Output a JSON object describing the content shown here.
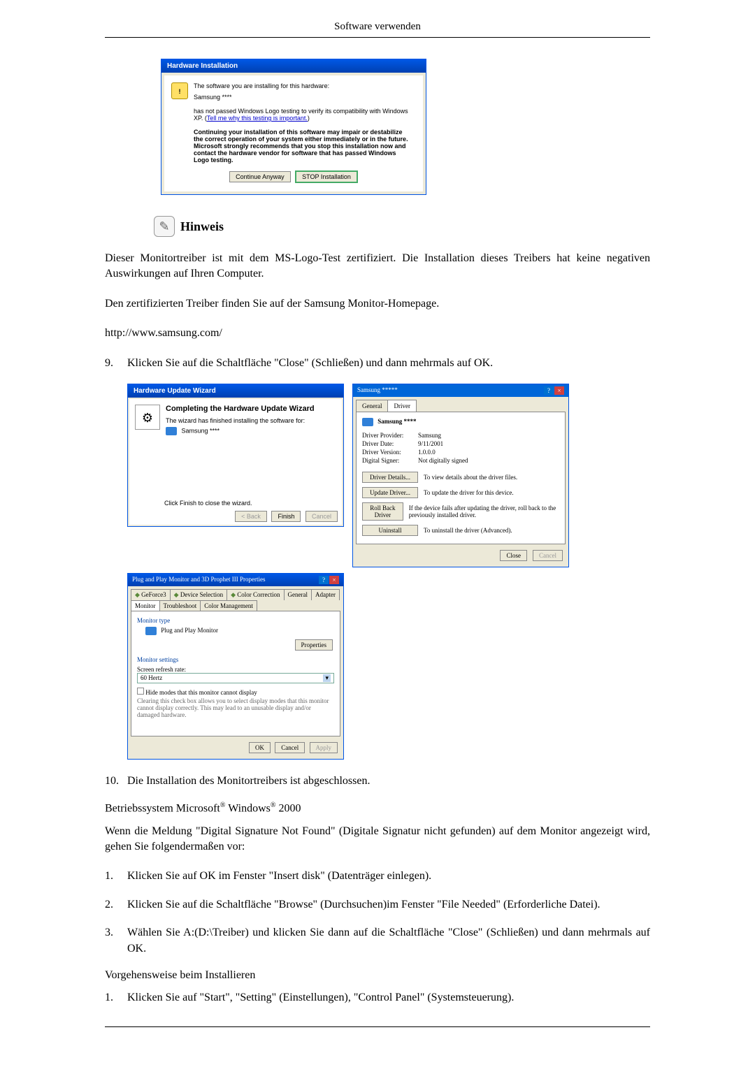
{
  "header": {
    "title": "Software verwenden"
  },
  "hwinstall": {
    "title": "Hardware Installation",
    "line1": "The software you are installing for this hardware:",
    "device": "Samsung ****",
    "line2a": "has not passed Windows Logo testing to verify its compatibility with Windows XP. (",
    "line2link": "Tell me why this testing is important.",
    "line2b": ")",
    "bold": "Continuing your installation of this software may impair or destabilize the correct operation of your system either immediately or in the future. Microsoft strongly recommends that you stop this installation now and contact the hardware vendor for software that has passed Windows Logo testing.",
    "btn_continue": "Continue Anyway",
    "btn_stop": "STOP Installation"
  },
  "note": {
    "label": "Hinweis",
    "para1": "Dieser Monitortreiber ist mit dem MS-Logo-Test zertifiziert. Die Installation dieses Treibers hat keine negativen Auswirkungen auf Ihren Computer.",
    "para2": "Den zertifizierten Treiber finden Sie auf der Samsung Monitor-Homepage.",
    "url": "http://www.samsung.com/"
  },
  "step9": {
    "num": "9.",
    "text": "Klicken Sie auf die Schaltfläche \"Close\" (Schließen) und dann mehrmals auf OK."
  },
  "wizard": {
    "title": "Hardware Update Wizard",
    "heading": "Completing the Hardware Update Wizard",
    "sub": "The wizard has finished installing the software for:",
    "device": "Samsung ****",
    "hint": "Click Finish to close the wizard.",
    "btn_back": "< Back",
    "btn_finish": "Finish",
    "btn_cancel": "Cancel"
  },
  "driverprops": {
    "title": "Samsung *****",
    "tab_general": "General",
    "tab_driver": "Driver",
    "device": "Samsung ****",
    "provider_k": "Driver Provider:",
    "provider_v": "Samsung",
    "date_k": "Driver Date:",
    "date_v": "9/11/2001",
    "version_k": "Driver Version:",
    "version_v": "1.0.0.0",
    "signer_k": "Digital Signer:",
    "signer_v": "Not digitally signed",
    "btn_details": "Driver Details...",
    "desc_details": "To view details about the driver files.",
    "btn_update": "Update Driver...",
    "desc_update": "To update the driver for this device.",
    "btn_rollback": "Roll Back Driver",
    "desc_rollback": "If the device fails after updating the driver, roll back to the previously installed driver.",
    "btn_uninstall": "Uninstall",
    "desc_uninstall": "To uninstall the driver (Advanced).",
    "btn_close": "Close",
    "btn_cancel": "Cancel"
  },
  "monprops": {
    "title": "Plug and Play Monitor and 3D Prophet III Properties",
    "tabs": {
      "geforce": "GeForce3",
      "devsel": "Device Selection",
      "colorcorr": "Color Correction",
      "general": "General",
      "adapter": "Adapter",
      "monitor": "Monitor",
      "trouble": "Troubleshoot",
      "colormgmt": "Color Management"
    },
    "montype_label": "Monitor type",
    "montype_value": "Plug and Play Monitor",
    "btn_properties": "Properties",
    "settings_label": "Monitor settings",
    "refresh_label": "Screen refresh rate:",
    "refresh_value": "60 Hertz",
    "hide_label": "Hide modes that this monitor cannot display",
    "hide_desc": "Clearing this check box allows you to select display modes that this monitor cannot display correctly. This may lead to an unusable display and/or damaged hardware.",
    "btn_ok": "OK",
    "btn_cancel": "Cancel",
    "btn_apply": "Apply"
  },
  "step10": {
    "num": "10.",
    "text": "Die Installation des Monitortreibers ist abgeschlossen."
  },
  "os2000": {
    "line_prefix": "Betriebssystem Microsoft",
    "mid": " Windows",
    "suffix": " 2000",
    "reg": "®",
    "para": "Wenn die Meldung \"Digital Signature Not Found\" (Digitale Signatur nicht gefunden) auf dem Monitor angezeigt wird, gehen Sie folgendermaßen vor:",
    "s1_num": "1.",
    "s1_text": "Klicken Sie auf OK im Fenster \"Insert disk\" (Datenträger einlegen).",
    "s2_num": "2.",
    "s2_text": "Klicken Sie auf die Schaltfläche \"Browse\" (Durchsuchen)im Fenster \"File Needed\" (Erforderliche Datei).",
    "s3_num": "3.",
    "s3_text": "Wählen Sie A:(D:\\Treiber) und klicken Sie dann auf die Schaltfläche \"Close\" (Schließen) und dann mehrmals auf OK.",
    "proc_label": "Vorgehensweise beim Installieren",
    "p1_num": "1.",
    "p1_text": "Klicken Sie auf \"Start\", \"Setting\" (Einstellungen), \"Control Panel\" (Systemsteuerung)."
  }
}
